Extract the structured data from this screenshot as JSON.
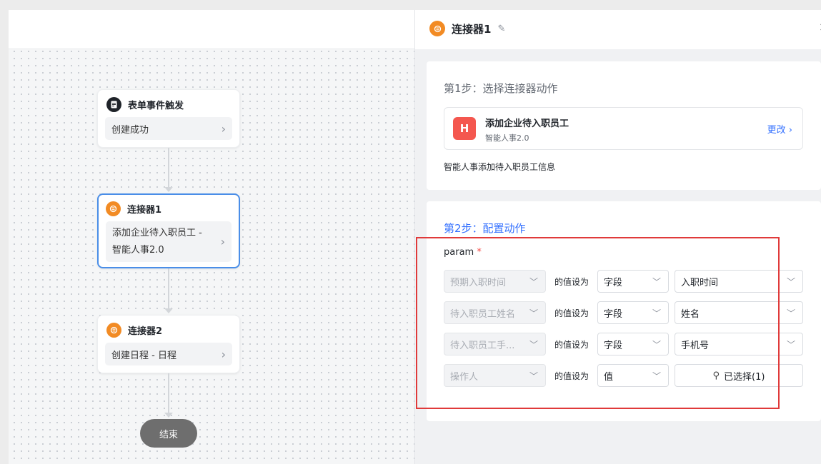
{
  "canvas": {
    "nodes": [
      {
        "title": "表单事件触发",
        "body": "创建成功",
        "icon": "document-icon"
      },
      {
        "title": "连接器1",
        "body_line1": "添加企业待入职员工 -",
        "body_line2": "智能人事2.0",
        "icon": "connector-icon"
      },
      {
        "title": "连接器2",
        "body": "创建日程 - 日程",
        "icon": "connector-icon"
      }
    ],
    "end_label": "结束"
  },
  "panel": {
    "title": "连接器1",
    "step1": {
      "label": "第1步：选择连接器动作",
      "action_name": "添加企业待入职员工",
      "action_app": "智能人事2.0",
      "change_label": "更改",
      "description": "智能人事添加待入职员工信息"
    },
    "step2": {
      "label": "第2步：配置动作",
      "param_label": "param",
      "required_mark": "*",
      "rows": [
        {
          "field": "预期入职时间",
          "mid": "的值设为",
          "type": "字段",
          "value": "入职时间"
        },
        {
          "field": "待入职员工姓名",
          "mid": "的值设为",
          "type": "字段",
          "value": "姓名"
        },
        {
          "field": "待入职员工手...",
          "mid": "的值设为",
          "type": "字段",
          "value": "手机号"
        },
        {
          "field": "操作人",
          "mid": "的值设为",
          "type": "值",
          "value": "已选择(1)"
        }
      ]
    }
  },
  "colors": {
    "accent": "#3370ff",
    "orange": "#f28b24",
    "highlight": "#e03a3a"
  }
}
